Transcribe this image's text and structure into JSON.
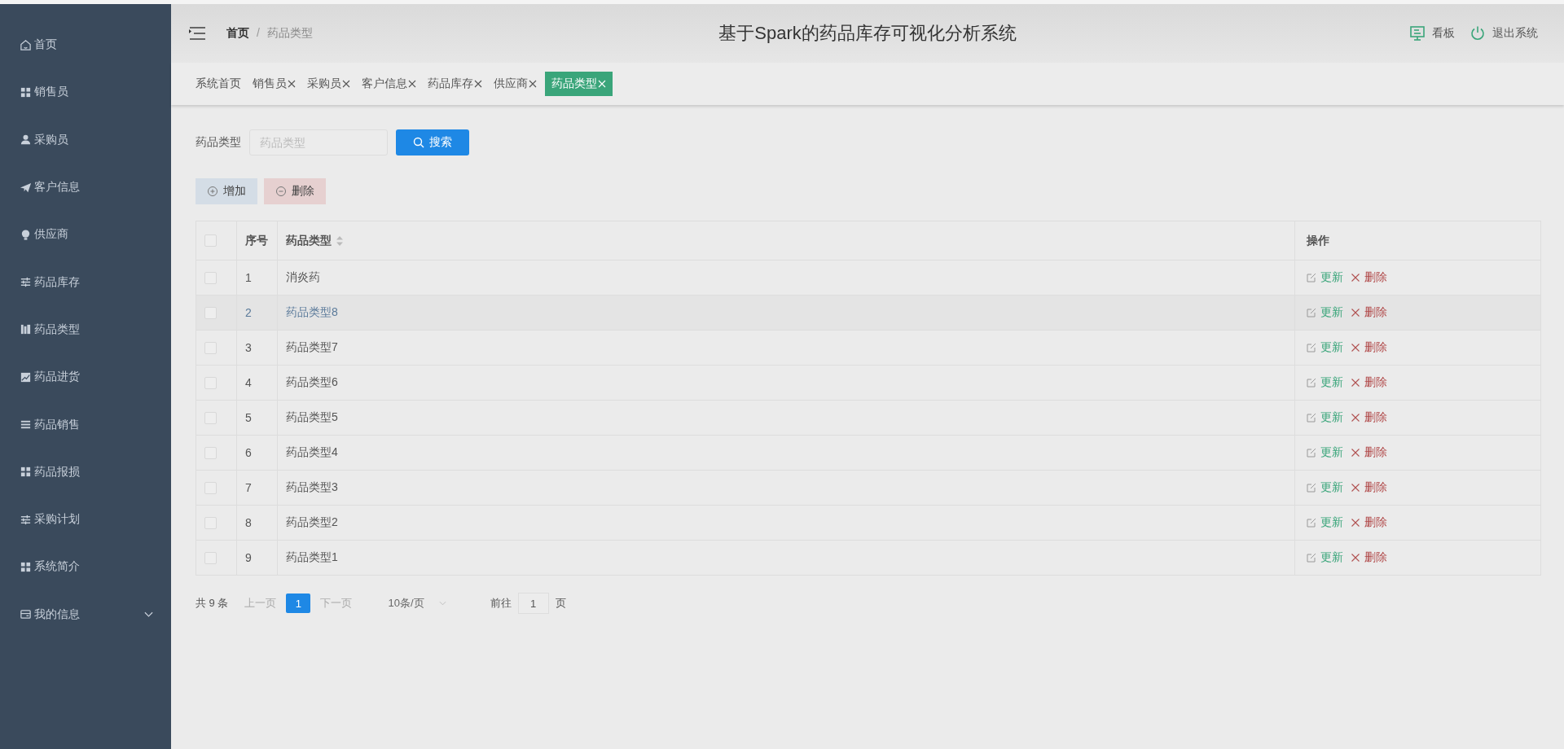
{
  "sidebar": {
    "items": [
      {
        "label": "首页",
        "selected": false
      },
      {
        "label": "销售员",
        "selected": false
      },
      {
        "label": "采购员",
        "selected": false
      },
      {
        "label": "客户信息",
        "selected": false
      },
      {
        "label": "供应商",
        "selected": false
      },
      {
        "label": "药品库存",
        "selected": false
      },
      {
        "label": "药品类型",
        "selected": false
      },
      {
        "label": "药品进货",
        "selected": false
      },
      {
        "label": "药品销售",
        "selected": false
      },
      {
        "label": "药品报损",
        "selected": false
      },
      {
        "label": "采购计划",
        "selected": false
      },
      {
        "label": "系统简介",
        "selected": false
      },
      {
        "label": "我的信息",
        "selected": false,
        "expanded": false
      }
    ]
  },
  "breadcrumb": {
    "items": [
      "首页",
      "药品类型"
    ],
    "separator": "/"
  },
  "title": "基于Spark的药品库存可视化分析系统",
  "header_actions": [
    "看板",
    "退出系统"
  ],
  "tabs": [
    {
      "label": "系统首页",
      "closable": false,
      "selected": false
    },
    {
      "label": "销售员",
      "closable": true,
      "selected": false
    },
    {
      "label": "采购员",
      "closable": true,
      "selected": false
    },
    {
      "label": "客户信息",
      "closable": true,
      "selected": false
    },
    {
      "label": "药品库存",
      "closable": true,
      "selected": false
    },
    {
      "label": "供应商",
      "closable": true,
      "selected": false
    },
    {
      "label": "药品类型",
      "closable": true,
      "selected": true
    }
  ],
  "search": {
    "label": "药品类型",
    "placeholder": "药品类型",
    "button": "搜索"
  },
  "actions": [
    "增加",
    "删除"
  ],
  "table": {
    "all_checked": false,
    "columns": [
      "序号",
      "药品类型",
      "操作"
    ],
    "rows": [
      {
        "index": "1",
        "name": "消炎药",
        "checked": false,
        "hovered": false,
        "actions": [
          "更新",
          "删除"
        ]
      },
      {
        "index": "2",
        "name": "药品类型8",
        "checked": false,
        "hovered": true,
        "actions": [
          "更新",
          "删除"
        ]
      },
      {
        "index": "3",
        "name": "药品类型7",
        "checked": false,
        "hovered": false,
        "actions": [
          "更新",
          "删除"
        ]
      },
      {
        "index": "4",
        "name": "药品类型6",
        "checked": false,
        "hovered": false,
        "actions": [
          "更新",
          "删除"
        ]
      },
      {
        "index": "5",
        "name": "药品类型5",
        "checked": false,
        "hovered": false,
        "actions": [
          "更新",
          "删除"
        ]
      },
      {
        "index": "6",
        "name": "药品类型4",
        "checked": false,
        "hovered": false,
        "actions": [
          "更新",
          "删除"
        ]
      },
      {
        "index": "7",
        "name": "药品类型3",
        "checked": false,
        "hovered": false,
        "actions": [
          "更新",
          "删除"
        ]
      },
      {
        "index": "8",
        "name": "药品类型2",
        "checked": false,
        "hovered": false,
        "actions": [
          "更新",
          "删除"
        ]
      },
      {
        "index": "9",
        "name": "药品类型1",
        "checked": false,
        "hovered": false,
        "actions": [
          "更新",
          "删除"
        ]
      }
    ]
  },
  "pagination": {
    "total": "共 9 条",
    "prev": "上一页",
    "pages": [
      {
        "label": "1",
        "selected": true
      }
    ],
    "next": "下一页",
    "size": "10条/页",
    "goto": "前往",
    "page": "1",
    "page_suffix": "页"
  }
}
